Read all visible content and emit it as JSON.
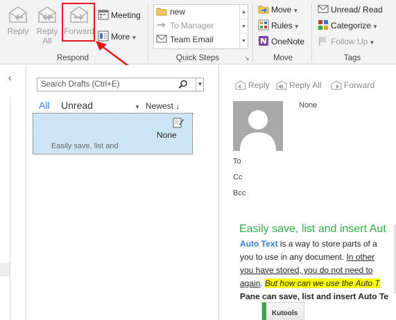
{
  "ribbon": {
    "respond": {
      "label": "Respond",
      "reply_label": "Reply",
      "reply_all_label_1": "Reply",
      "reply_all_label_2": "All",
      "forward_label": "Forward",
      "meeting_label": "Meeting",
      "more_label": "More"
    },
    "quick_steps": {
      "label": "Quick Steps",
      "items": [
        "new",
        "To Manager",
        "Team Email"
      ]
    },
    "move": {
      "label": "Move",
      "move_label": "Move",
      "rules_label": "Rules",
      "onenote_label": "OneNote"
    },
    "tags": {
      "label": "Tags",
      "unread_read_label": "Unread/ Read",
      "categorize_label": "Categorize",
      "follow_up_label": "Follow Up"
    }
  },
  "message_list": {
    "search_placeholder": "Search Drafts (Ctrl+E)",
    "filter_all": "All",
    "filter_unread": "Unread",
    "sort_label": "Newest",
    "messages": [
      {
        "from": "None",
        "preview": "Easily save, list and"
      }
    ]
  },
  "reading_pane": {
    "reply_label": "Reply",
    "reply_all_label": "Reply All",
    "forward_label": "Forward",
    "sender": "None",
    "to_label": "To",
    "cc_label": "Cc",
    "bcc_label": "Bcc",
    "body_title": "Easily save, list and insert Aut",
    "auto_text": "Auto Text",
    "line1_rest": " is a way to store parts of a",
    "line2_a": "you to use in any document. ",
    "line2_b": "In other",
    "line3": "you have stored, you do not need to",
    "line4_a": "again",
    "line4_b": ". ",
    "line4_c": "But how can we use the Auto T",
    "line5": "Pane can save, list and insert Auto Te",
    "kutools_label": "Kutools"
  },
  "colors": {
    "accent_blue": "#2b7cd3",
    "selection_blue": "#cde6f7",
    "highlight_red": "#e8141b",
    "title_green": "#2eaa4a",
    "highlight_yellow": "#ffff00"
  },
  "icons": [
    "reply-icon",
    "reply-all-icon",
    "forward-icon",
    "meeting-icon",
    "more-icon",
    "move-icon",
    "rules-icon",
    "onenote-icon",
    "unread-read-icon",
    "categorize-icon",
    "follow-up-flag-icon",
    "search-icon",
    "draft-icon",
    "collapse-arrow-icon",
    "avatar-icon"
  ]
}
